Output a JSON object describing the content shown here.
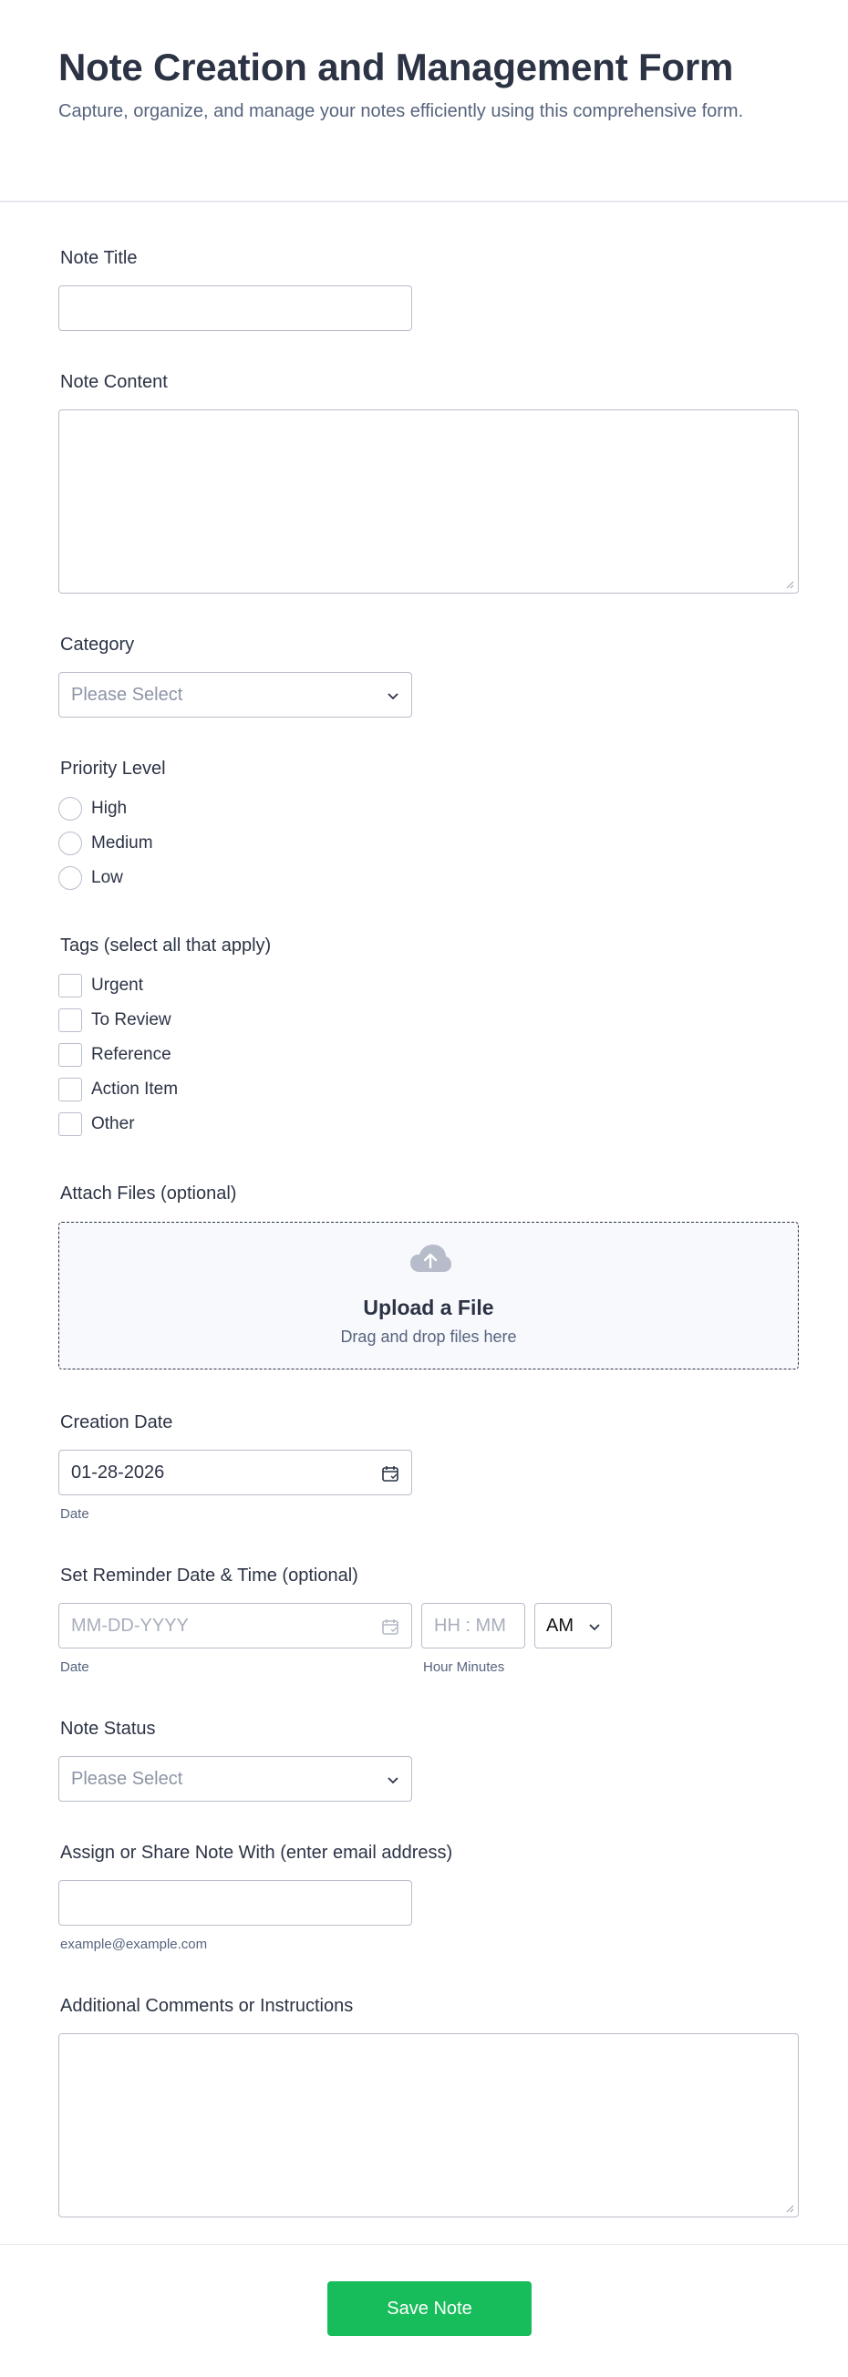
{
  "header": {
    "title": "Note Creation and Management Form",
    "subtitle": "Capture, organize, and manage your notes efficiently using this comprehensive form."
  },
  "fields": {
    "note_title": {
      "label": "Note Title",
      "value": ""
    },
    "note_content": {
      "label": "Note Content",
      "value": ""
    },
    "category": {
      "label": "Category",
      "placeholder": "Please Select"
    },
    "priority": {
      "label": "Priority Level",
      "options": [
        "High",
        "Medium",
        "Low"
      ]
    },
    "tags": {
      "label": "Tags (select all that apply)",
      "options": [
        "Urgent",
        "To Review",
        "Reference",
        "Action Item",
        "Other"
      ]
    },
    "attach": {
      "label": "Attach Files (optional)",
      "upload_title": "Upload a File",
      "upload_sub": "Drag and drop files here",
      "icon": "cloud-upload-icon"
    },
    "creation_date": {
      "label": "Creation Date",
      "value": "01-28-2026",
      "sublabel": "Date"
    },
    "reminder": {
      "label": "Set Reminder Date & Time (optional)",
      "date_placeholder": "MM-DD-YYYY",
      "time_placeholder": "HH : MM",
      "ampm": "AM",
      "date_sublabel": "Date",
      "time_sublabel": "Hour Minutes"
    },
    "status": {
      "label": "Note Status",
      "placeholder": "Please Select"
    },
    "assign": {
      "label": "Assign or Share Note With (enter email address)",
      "value": "",
      "sublabel": "example@example.com"
    },
    "comments": {
      "label": "Additional Comments or Instructions",
      "value": ""
    }
  },
  "footer": {
    "save_label": "Save Note",
    "accent": "#18bd5b"
  }
}
